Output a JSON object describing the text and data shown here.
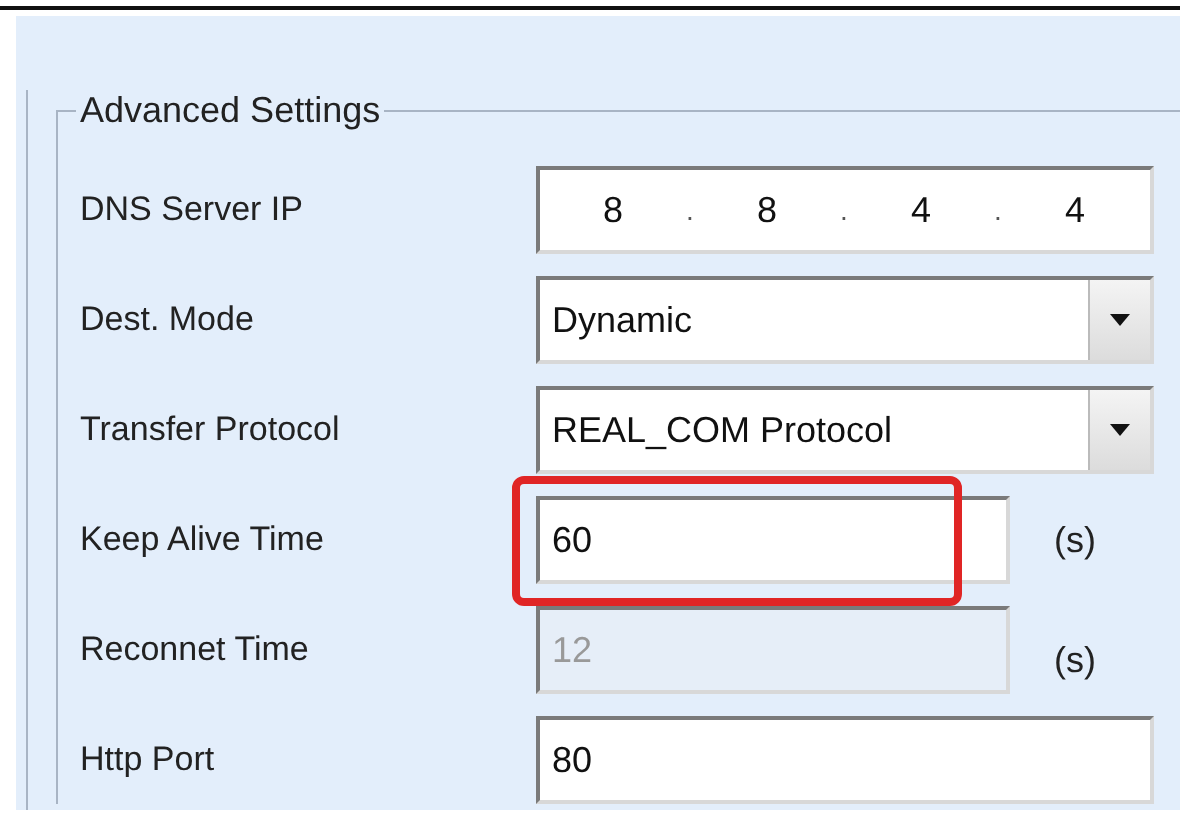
{
  "group": {
    "title": "Advanced Settings",
    "rows": [
      {
        "kind": "ip",
        "label": "DNS Server IP",
        "octets": [
          "8",
          "8",
          "4",
          "4"
        ],
        "separators": [
          ".",
          ".",
          "."
        ]
      },
      {
        "kind": "select",
        "label": "Dest. Mode",
        "value": "Dynamic"
      },
      {
        "kind": "select",
        "label": "Transfer Protocol",
        "value": "REAL_COM Protocol"
      },
      {
        "kind": "text",
        "label": "Keep Alive Time",
        "value": "60",
        "unit": "(s)",
        "disabled": false,
        "highlighted": true
      },
      {
        "kind": "text",
        "label": "Reconnet Time",
        "value": "12",
        "unit": "(s)",
        "disabled": true,
        "highlighted": false
      },
      {
        "kind": "text",
        "label": "Http Port",
        "value": "80",
        "disabled": false,
        "highlighted": false
      }
    ]
  }
}
